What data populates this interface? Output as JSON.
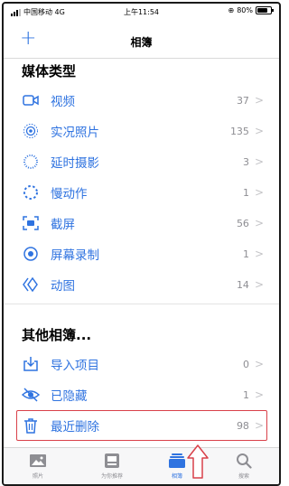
{
  "status_bar": {
    "carrier": "中国移动 4G",
    "time": "上午11:54",
    "battery": "80%"
  },
  "nav": {
    "add_icon": "+",
    "title": "相簿"
  },
  "media_types": {
    "title": "媒体类型",
    "items": [
      {
        "icon": "video-icon",
        "label": "视频",
        "count": "37"
      },
      {
        "icon": "live-photo-icon",
        "label": "实况照片",
        "count": "135"
      },
      {
        "icon": "timelapse-icon",
        "label": "延时摄影",
        "count": "3"
      },
      {
        "icon": "slowmo-icon",
        "label": "慢动作",
        "count": "1"
      },
      {
        "icon": "screenshot-icon",
        "label": "截屏",
        "count": "56"
      },
      {
        "icon": "screen-record-icon",
        "label": "屏幕录制",
        "count": "1"
      },
      {
        "icon": "animated-icon",
        "label": "动图",
        "count": "14"
      }
    ]
  },
  "other_albums": {
    "title": "其他相簿...",
    "items": [
      {
        "icon": "import-icon",
        "label": "导入项目",
        "count": "0"
      },
      {
        "icon": "hidden-icon",
        "label": "已隐藏",
        "count": "1"
      },
      {
        "icon": "trash-icon",
        "label": "最近删除",
        "count": "98"
      }
    ]
  },
  "tab_bar": [
    {
      "icon": "photos-tab-icon",
      "label": "照片",
      "active": false
    },
    {
      "icon": "for-you-tab-icon",
      "label": "为你推荐",
      "active": false
    },
    {
      "icon": "albums-tab-icon",
      "label": "相簿",
      "active": true
    },
    {
      "icon": "search-tab-icon",
      "label": "搜索",
      "active": false
    }
  ],
  "colors": {
    "accent": "#2f73e0",
    "highlight": "#d9414a",
    "secondary": "#8e8e93"
  }
}
